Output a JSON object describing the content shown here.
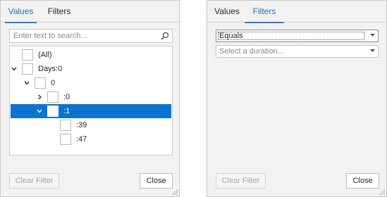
{
  "left": {
    "tabs": [
      {
        "label": "Values",
        "active": true
      },
      {
        "label": "Filters",
        "active": false
      }
    ],
    "search": {
      "placeholder": "Enter text to search...",
      "value": ""
    },
    "tree": [
      {
        "label": "(All)",
        "level": 0,
        "expander": "none",
        "checked": false,
        "selected": false
      },
      {
        "label": "Days:0",
        "level": 0,
        "expander": "expanded",
        "checked": false,
        "selected": false
      },
      {
        "label": "0",
        "level": 1,
        "expander": "expanded",
        "checked": false,
        "selected": false
      },
      {
        "label": ":0",
        "level": 2,
        "expander": "collapsed",
        "checked": false,
        "selected": false
      },
      {
        "label": ":1",
        "level": 2,
        "expander": "expanded",
        "checked": false,
        "selected": true
      },
      {
        "label": ":39",
        "level": 3,
        "expander": "none",
        "checked": false,
        "selected": false
      },
      {
        "label": ":47",
        "level": 3,
        "expander": "none",
        "checked": false,
        "selected": false
      }
    ],
    "buttons": {
      "clear_filter": "Clear Filter",
      "close": "Close"
    }
  },
  "right": {
    "tabs": [
      {
        "label": "Values",
        "active": false
      },
      {
        "label": "Filters",
        "active": true
      }
    ],
    "operator": {
      "value": "Equals"
    },
    "duration": {
      "placeholder": "Select a duration..."
    },
    "buttons": {
      "clear_filter": "Clear Filter",
      "close": "Close"
    }
  },
  "colors": {
    "accent": "#2b7cd3",
    "selection": "#0c73d0",
    "panel": "#f2f2f2"
  },
  "icons": [
    "search-icon",
    "chevron-down-icon",
    "chevron-right-icon",
    "dropdown-arrow-icon",
    "resize-grip-icon"
  ]
}
